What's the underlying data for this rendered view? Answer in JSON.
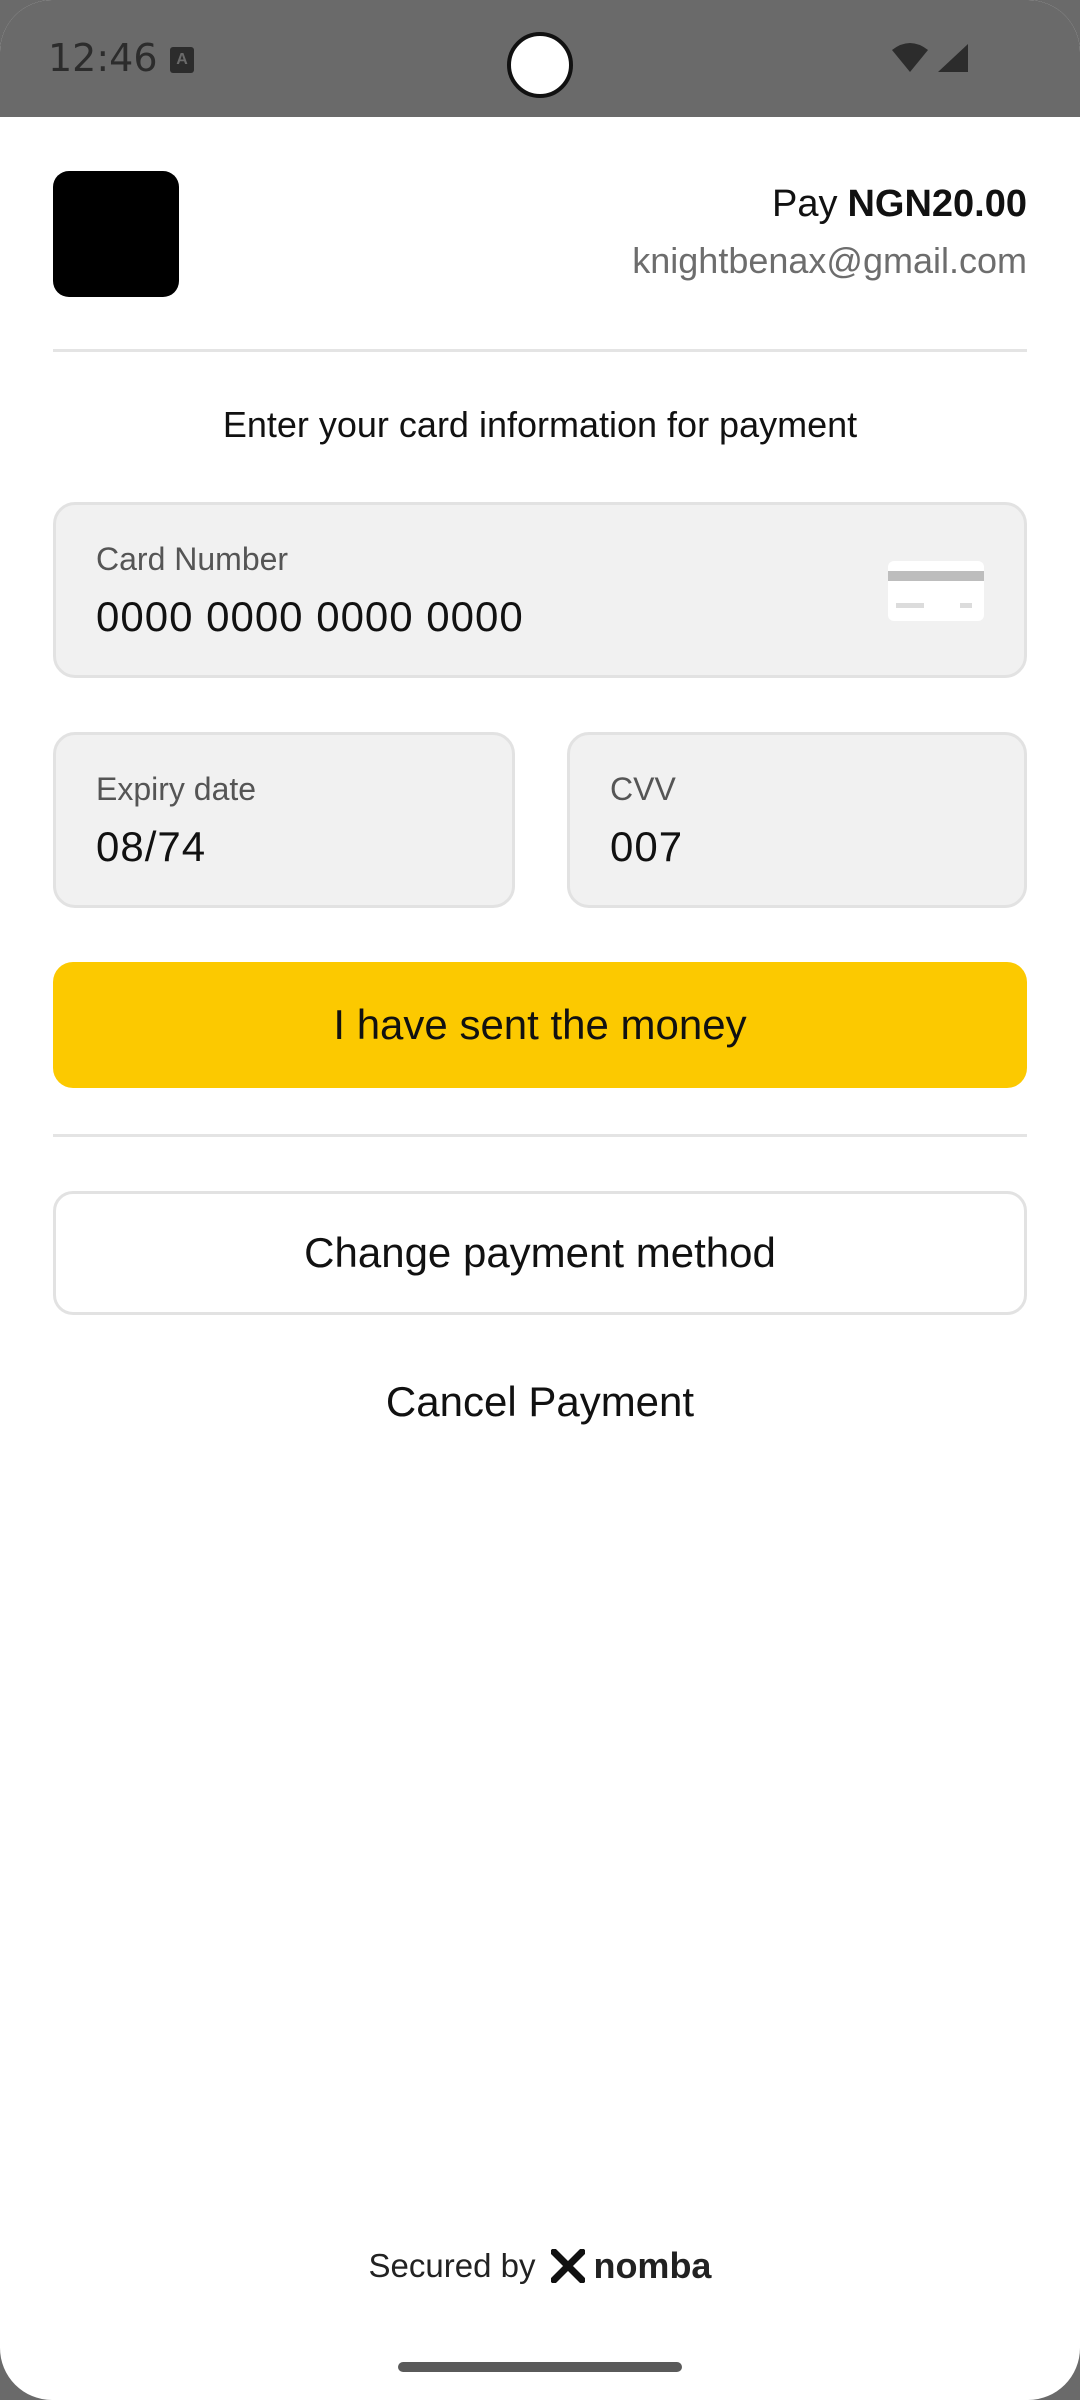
{
  "status_bar": {
    "time": "12:46",
    "notification_icon": "a-square-icon",
    "wifi_icon": "wifi-icon",
    "signal_icon": "signal-icon"
  },
  "header": {
    "pay_label": "Pay",
    "amount": "NGN20.00",
    "email": "knightbenax@gmail.com"
  },
  "instruction": "Enter your card information for payment",
  "card_number": {
    "label": "Card Number",
    "value": "0000 0000 0000 0000",
    "icon": "credit-card-icon"
  },
  "expiry": {
    "label": "Expiry date",
    "value": "08/74"
  },
  "cvv": {
    "label": "CVV",
    "value": "007"
  },
  "actions": {
    "sent_money": "I have sent the money",
    "change_method": "Change payment method",
    "cancel": "Cancel Payment"
  },
  "footer": {
    "secured_by": "Secured by",
    "brand": "nomba"
  },
  "colors": {
    "accent": "#fcc900",
    "status_bar": "#6a6a6a",
    "field_bg": "#f1f1f1"
  }
}
